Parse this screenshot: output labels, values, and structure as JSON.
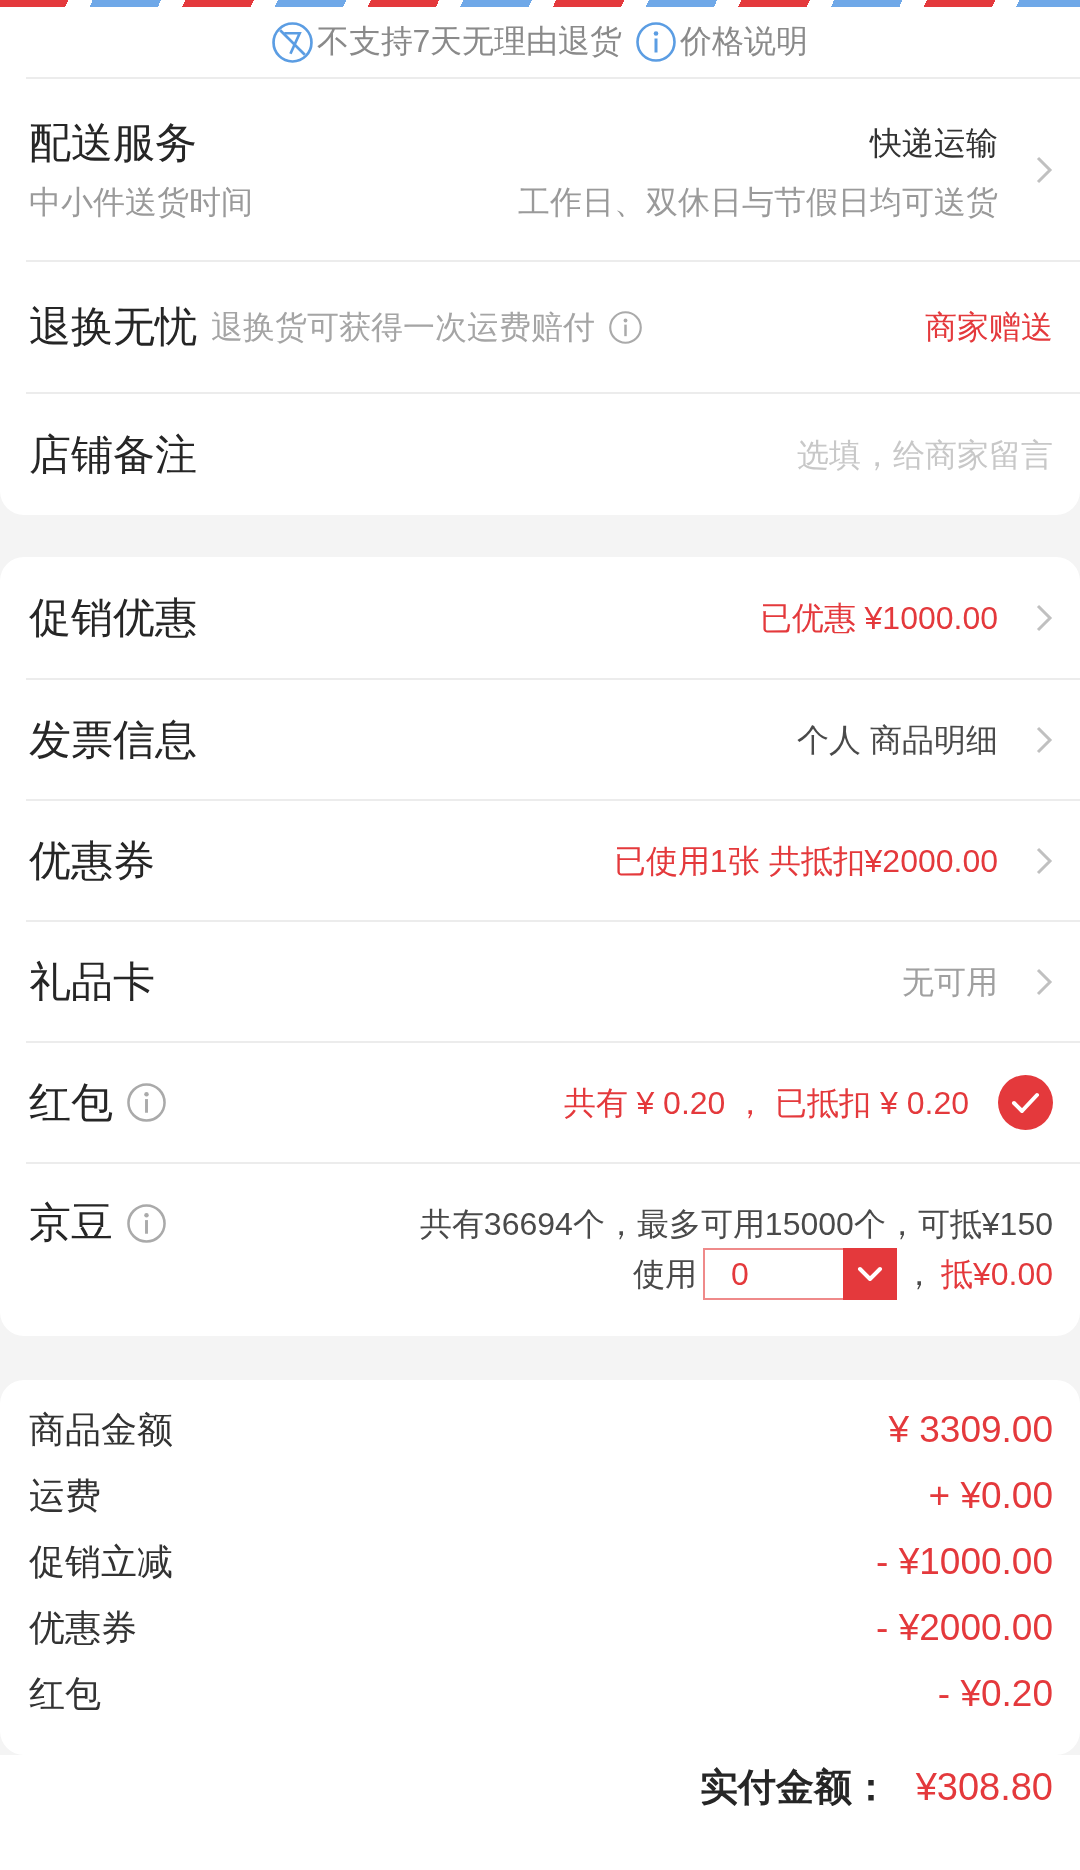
{
  "notices": [
    {
      "kind": "no-return",
      "text": "不支持7天无理由退货"
    },
    {
      "kind": "info",
      "text": "价格说明"
    }
  ],
  "shop": {
    "delivery": {
      "title": "配送服务",
      "method": "快递运输",
      "subtitle": "中小件送货时间",
      "schedule": "工作日、双休日与节假日均可送货"
    },
    "return_insurance": {
      "title": "退换无忧",
      "description": "退换货可获得一次运费赔付",
      "value": "商家赠送"
    },
    "note": {
      "title": "店铺备注",
      "placeholder": "选填，给商家留言"
    }
  },
  "payment_rows": [
    {
      "kind": "link",
      "title": "促销优惠",
      "value": "已优惠 ¥1000.00",
      "highlighted": true,
      "disabled": false
    },
    {
      "kind": "link",
      "title": "发票信息",
      "value": "个人 商品明细",
      "highlighted": false,
      "disabled": false
    },
    {
      "kind": "link",
      "title": "优惠券",
      "value": "已使用1张 共抵扣¥2000.00",
      "highlighted": true,
      "disabled": false
    },
    {
      "kind": "link",
      "title": "礼品卡",
      "value": "无可用",
      "highlighted": false,
      "disabled": true
    },
    {
      "kind": "toggle",
      "title": "红包",
      "value": "共有 ¥ 0.20 ， 已抵扣 ¥ 0.20",
      "highlighted": true,
      "disabled": false,
      "checked": true
    },
    {
      "kind": "beans",
      "title": "京豆",
      "summary": "共有36694个，最多可用15000个，可抵¥150",
      "use_label": "使用",
      "quantity": "0",
      "separator": "，",
      "deduction": "抵¥0.00"
    }
  ],
  "summary": [
    {
      "label": "商品金额",
      "amount": "¥ 3309.00"
    },
    {
      "label": "运费",
      "amount": "+ ¥0.00"
    },
    {
      "label": "促销立减",
      "amount": "- ¥1000.00"
    },
    {
      "label": "优惠券",
      "amount": "- ¥2000.00"
    },
    {
      "label": "红包",
      "amount": "- ¥0.20"
    }
  ],
  "total": {
    "label": "实付金额：",
    "amount": "¥308.80"
  }
}
